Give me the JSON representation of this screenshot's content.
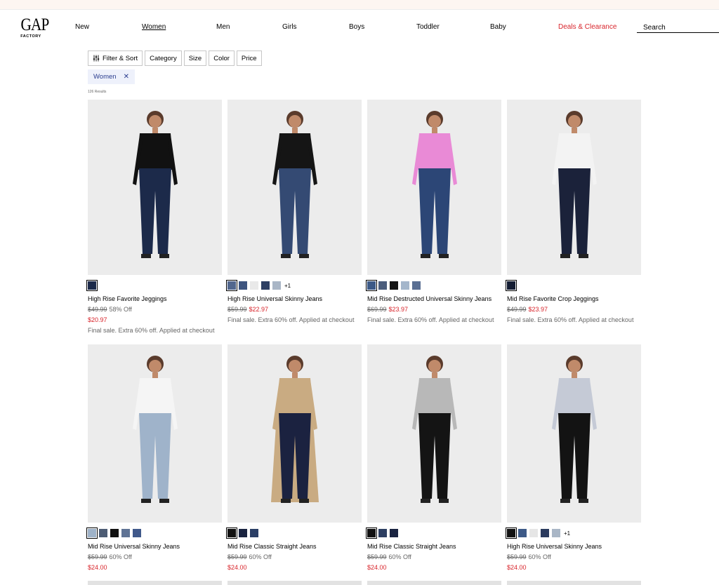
{
  "brand": {
    "name": "GAP",
    "sub": "FACTORY"
  },
  "nav": [
    "New",
    "Women",
    "Men",
    "Girls",
    "Boys",
    "Toddler",
    "Baby",
    "Deals & Clearance"
  ],
  "search": {
    "placeholder": "Search"
  },
  "filters": [
    "Filter & Sort",
    "Category",
    "Size",
    "Color",
    "Price"
  ],
  "active_filter": "Women",
  "results": "126 Results",
  "colors": {
    "sale": "#d8242b",
    "chip_bg": "#eef1fb",
    "chip_text": "#2a3d8f"
  },
  "products": [
    {
      "name": "High Rise Favorite Jeggings",
      "old": "$49.99",
      "off": "58% Off",
      "price": "$20.97",
      "promo": "Final sale. Extra 60% off. Applied at checkout",
      "swatches": [
        "#1c2a4a"
      ],
      "more": ""
    },
    {
      "name": "High Rise Universal Skinny Jeans",
      "old": "$59.99",
      "off": "",
      "price": "$22.97",
      "promo": "Final sale. Extra 60% off. Applied at checkout",
      "swatches": [
        "#52678e",
        "#3e5580",
        "#e9e9e9",
        "#2d3f63",
        "#a9b6c6"
      ],
      "more": "+1"
    },
    {
      "name": "Mid Rise Destructed Universal Skinny Jeans",
      "old": "$69.99",
      "off": "",
      "price": "$23.97",
      "promo": "Final sale. Extra 60% off. Applied at checkout",
      "swatches": [
        "#3d5a87",
        "#4b5d7c",
        "#151515",
        "#a4b6cb",
        "#5a6f93"
      ],
      "more": ""
    },
    {
      "name": "Mid Rise Favorite Crop Jeggings",
      "old": "$49.99",
      "off": "",
      "price": "$23.97",
      "promo": "Final sale. Extra 60% off. Applied at checkout",
      "swatches": [
        "#141d33"
      ],
      "more": ""
    },
    {
      "name": "Mid Rise Universal Skinny Jeans",
      "old": "$59.99",
      "off": "60% Off",
      "price": "$24.00",
      "promo": "",
      "swatches": [
        "#9eb2c8",
        "#4d5c74",
        "#121212",
        "#5f7394",
        "#40598a"
      ],
      "more": ""
    },
    {
      "name": "Mid Rise Classic Straight Jeans",
      "old": "$59.99",
      "off": "60% Off",
      "price": "$24.00",
      "promo": "",
      "swatches": [
        "#111111",
        "#1a2440",
        "#2b3f66"
      ],
      "more": ""
    },
    {
      "name": "Mid Rise Classic Straight Jeans",
      "old": "$59.99",
      "off": "60% Off",
      "price": "$24.00",
      "promo": "",
      "swatches": [
        "#111111",
        "#2e3f62",
        "#1a2441"
      ],
      "more": ""
    },
    {
      "name": "High Rise Universal Skinny Jeans",
      "old": "$59.99",
      "off": "60% Off",
      "price": "$24.00",
      "promo": "",
      "swatches": [
        "#121212",
        "#3d5a87",
        "#e6e6e6",
        "#2b3b5e",
        "#a9b6c6"
      ],
      "more": "+1"
    }
  ]
}
